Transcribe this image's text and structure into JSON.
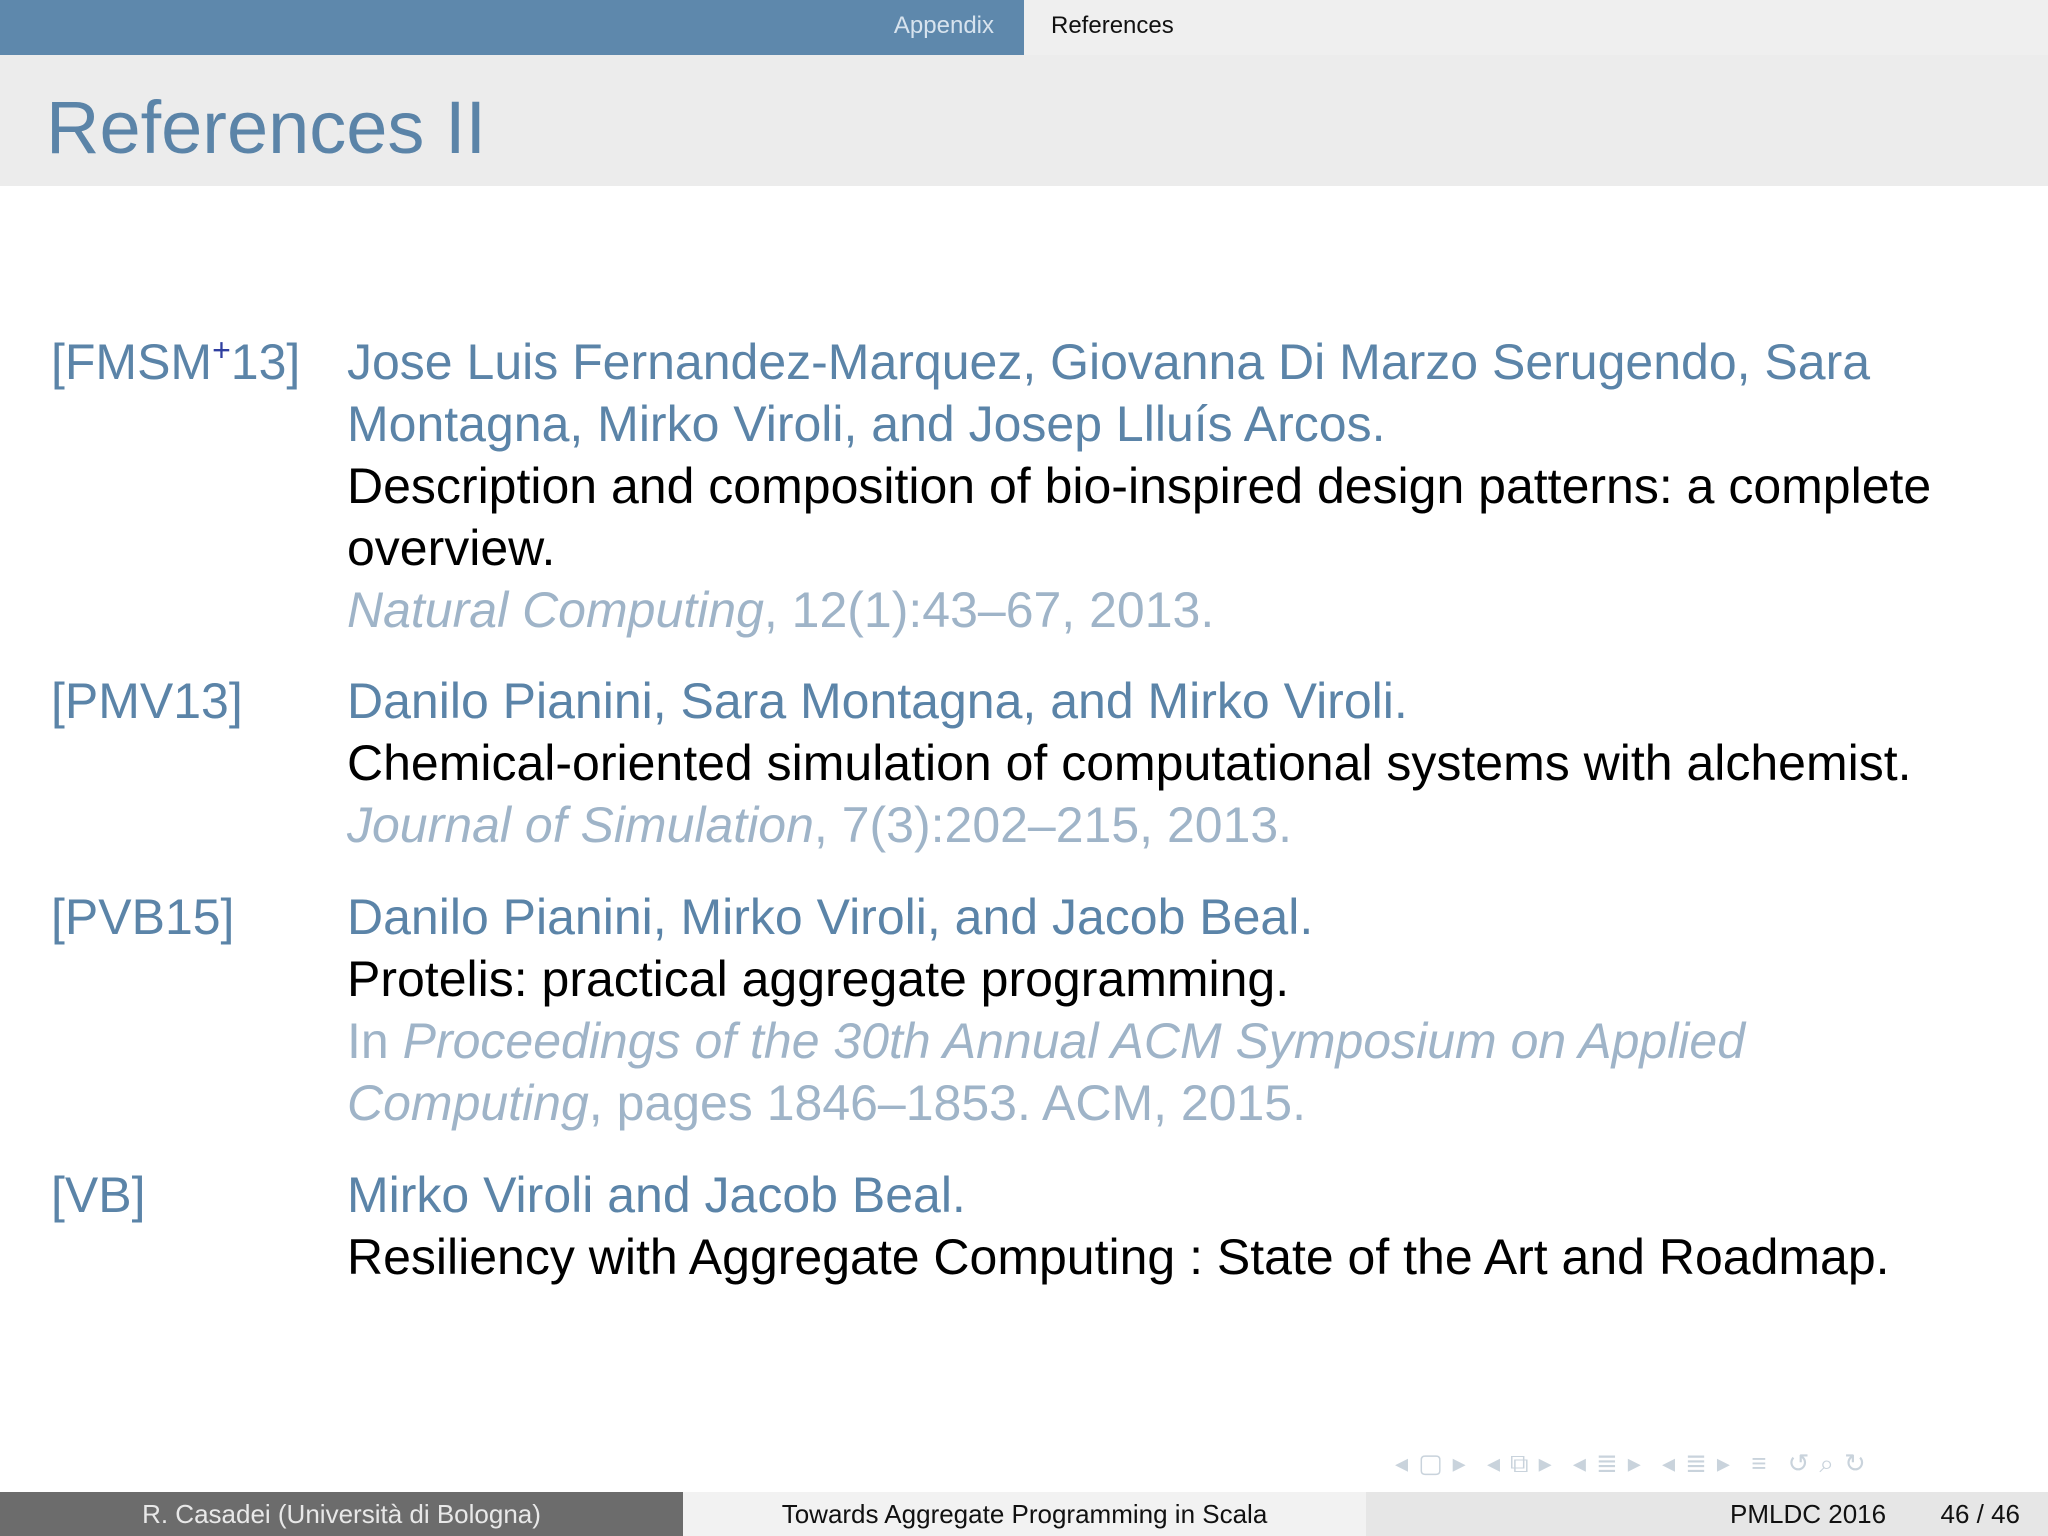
{
  "header": {
    "section": "Appendix",
    "subsection": "References"
  },
  "frame": {
    "title": "References II"
  },
  "references": [
    {
      "label": "[FMSM",
      "label_sup": "+",
      "label_tail": "13]",
      "author_lines": [
        "Jose Luis Fernandez-Marquez, Giovanna Di Marzo Serugendo, Sara",
        "Montagna, Mirko Viroli, and Josep Llluís Arcos."
      ],
      "title_lines": [
        "Description and composition of bio-inspired design patterns: a complete",
        "overview."
      ],
      "venue_lines": [
        {
          "prefix": "",
          "italic": "Natural Computing",
          "rest": ", 12(1):43–67, 2013."
        }
      ]
    },
    {
      "label": "[PMV13]",
      "author_lines": [
        "Danilo Pianini, Sara Montagna, and Mirko Viroli."
      ],
      "title_lines": [
        "Chemical-oriented simulation of computational systems with alchemist."
      ],
      "venue_lines": [
        {
          "prefix": "",
          "italic": "Journal of Simulation",
          "rest": ", 7(3):202–215, 2013."
        }
      ]
    },
    {
      "label": "[PVB15]",
      "author_lines": [
        "Danilo Pianini, Mirko Viroli, and Jacob Beal."
      ],
      "title_lines": [
        "Protelis: practical aggregate programming."
      ],
      "venue_lines": [
        {
          "prefix": "In ",
          "italic": "Proceedings of the 30th Annual ACM Symposium on Applied",
          "rest": ""
        },
        {
          "prefix": "",
          "italic": "Computing",
          "rest": ", pages 1846–1853. ACM, 2015."
        }
      ]
    },
    {
      "label": "[VB]",
      "author_lines": [
        "Mirko Viroli and Jacob Beal."
      ],
      "title_lines": [
        "Resiliency with Aggregate Computing : State of the Art and Roadmap."
      ],
      "venue_lines": []
    }
  ],
  "nav_icons": [
    "nav-frame-prev-icon",
    "nav-frame-icon",
    "nav-frame-next-icon",
    "nav-subsection-prev-icon",
    "nav-subsection-icon",
    "nav-subsection-next-icon",
    "nav-section-prev-icon",
    "nav-section-icon",
    "nav-section-next-icon",
    "nav-doc-prev-icon",
    "nav-doc-icon",
    "nav-doc-next-icon",
    "nav-toc-icon",
    "nav-back-icon",
    "nav-search-icon",
    "nav-forward-icon"
  ],
  "footer": {
    "author": "R. Casadei  (Università di Bologna)",
    "talk_title": "Towards Aggregate Programming in Scala",
    "conference": "PMLDC 2016",
    "page": "46 / 46"
  },
  "colors": {
    "accent": "#5e88ac",
    "author_text": "#5b84a8",
    "venue_text": "#9fb4c8"
  }
}
